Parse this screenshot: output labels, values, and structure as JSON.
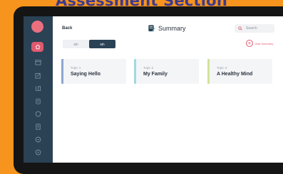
{
  "banner": {
    "title": "Assessment Section"
  },
  "header": {
    "back_label": "Back",
    "title": "Summary",
    "search_placeholder": "Search"
  },
  "grade_tabs": [
    {
      "label": "6th",
      "active": false
    },
    {
      "label": "6th",
      "active": true
    }
  ],
  "add_button": {
    "label": "Add Summary"
  },
  "topics": [
    {
      "topic_label": "Topic 1",
      "name": "Saying Hello",
      "accent": "#8fa6d0"
    },
    {
      "topic_label": "Topic 2",
      "name": "My Family",
      "accent": "#9fdadf"
    },
    {
      "topic_label": "Topic 3",
      "name": "A Healthy Mind",
      "accent": "#cfe39a"
    }
  ],
  "sidebar": {
    "icons": [
      "home-icon",
      "calendar-icon",
      "edit-icon",
      "book-icon",
      "clipboard-icon",
      "shield-icon",
      "document-icon",
      "chat-icon",
      "help-icon"
    ]
  },
  "colors": {
    "background": "#f7941d",
    "sidebar": "#2b4255",
    "accent": "#e0596e",
    "banner_text": "#3b3a8f"
  }
}
